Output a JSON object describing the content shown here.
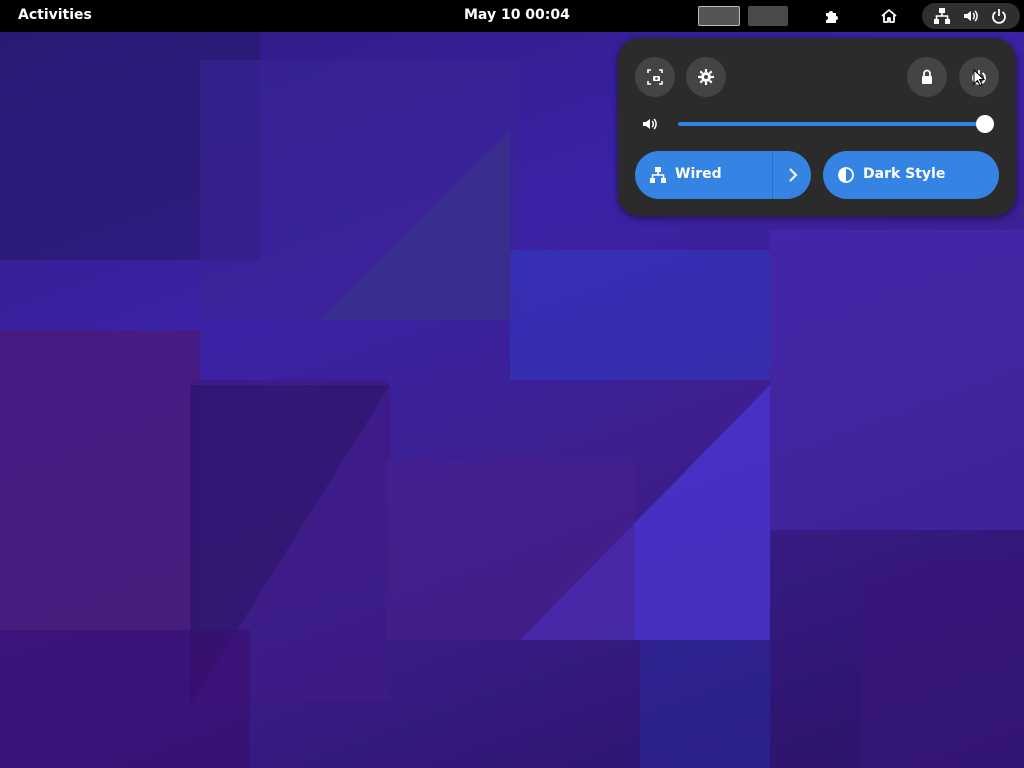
{
  "topbar": {
    "activities_label": "Activities",
    "clock": "May 10  00:04",
    "workspaces": [
      {
        "name": "workspace-1",
        "active": true
      },
      {
        "name": "workspace-2",
        "active": false
      }
    ],
    "icons": [
      "extensions-icon",
      "home-icon",
      "network-wired-icon",
      "volume-icon",
      "power-icon"
    ]
  },
  "quick_settings": {
    "top_buttons": [
      "screenshot-icon",
      "settings-icon",
      "lock-icon",
      "power-off-icon"
    ],
    "volume": {
      "icon": "volume-icon",
      "level": 1.0
    },
    "toggles": [
      {
        "label": "Wired",
        "icon": "network-wired-icon",
        "active": true,
        "has_arrow": true
      },
      {
        "label": "Dark Style",
        "icon": "dark-style-icon",
        "active": true,
        "has_arrow": false
      }
    ]
  },
  "colors": {
    "accent": "#3584e4",
    "panel_bg": "#2b2b2b",
    "topbar_bg": "#000000"
  }
}
